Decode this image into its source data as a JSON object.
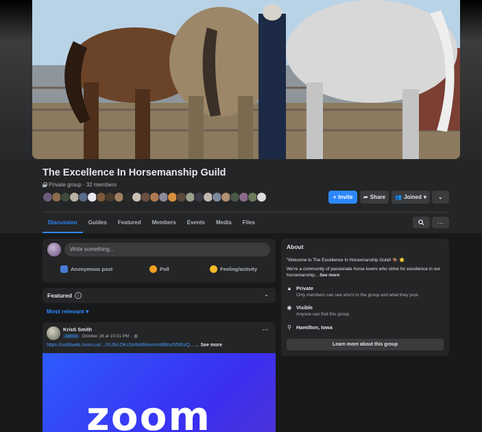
{
  "group": {
    "name": "The Excellence In Horsemanship Guild",
    "meta": "Private group · 32 members"
  },
  "actions": {
    "invite": "Invite",
    "share": "Share",
    "joined": "Joined"
  },
  "tabs": [
    "Discussion",
    "Guides",
    "Featured",
    "Members",
    "Events",
    "Media",
    "Files"
  ],
  "active_tab": "Discussion",
  "composer": {
    "placeholder": "Write something...",
    "anonymous": "Anonymous post",
    "poll": "Poll",
    "feeling": "Feeling/activity"
  },
  "featured": {
    "label": "Featured",
    "info": "i",
    "sort": "Most relevant"
  },
  "post": {
    "author": "Kristi Smith",
    "badge": "Admin",
    "time": "October 28 at 10:01 PM ·",
    "link": "https://us06web.zoom.us/.../XU5iLOKc0mfsMMexmm88lmz559hzQ...",
    "ellipsis": " ... ",
    "see_more": "See more",
    "image_word": "zoom"
  },
  "about": {
    "heading": "About",
    "welcome": "\"Welcome to The Excellence In Horsemanship Guild! 🏇 🌟",
    "desc": "We're a community of passionate horse lovers who strive for excellence in our horsemanship... ",
    "see_more": "See more",
    "private_title": "Private",
    "private_desc": "Only members can see who's in the group and what they post.",
    "visible_title": "Visible",
    "visible_desc": "Anyone can find this group.",
    "location": "Hamilton, Iowa",
    "learn_more": "Learn more about this group"
  },
  "icons": {
    "search": "search-icon",
    "more": "more-icon",
    "lock": "lock-icon",
    "eye": "eye-icon",
    "pin": "location-pin-icon"
  },
  "colors": {
    "accent": "#2d88ff",
    "background": "#18191a",
    "card": "#242526",
    "zoom_blue": "#2e5bff"
  }
}
